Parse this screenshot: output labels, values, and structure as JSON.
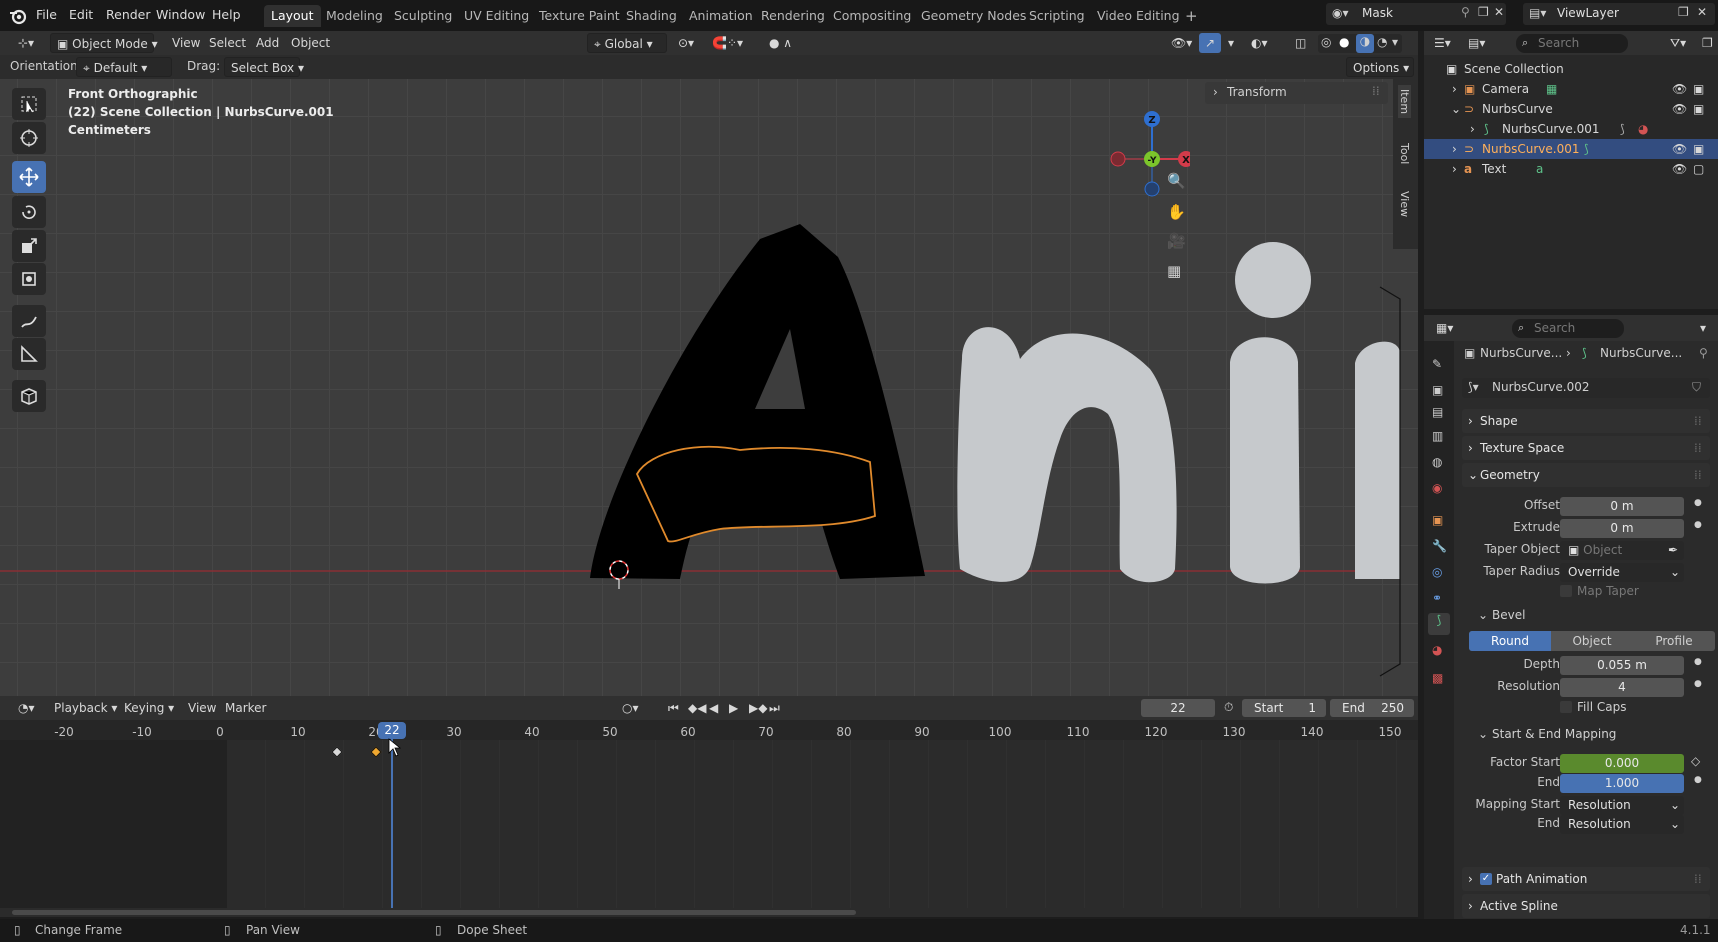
{
  "app": {
    "version": "4.1.1"
  },
  "menu": [
    "File",
    "Edit",
    "Render",
    "Window",
    "Help"
  ],
  "workspaces": [
    "Layout",
    "Modeling",
    "Sculpting",
    "UV Editing",
    "Texture Paint",
    "Shading",
    "Animation",
    "Rendering",
    "Compositing",
    "Geometry Nodes",
    "Scripting",
    "Video Editing"
  ],
  "scene_field": "Mask",
  "viewlayer_field": "ViewLayer",
  "viewport": {
    "mode": "Object Mode",
    "header_menus": [
      "View",
      "Select",
      "Add",
      "Object"
    ],
    "orientation_label": "Orientation:",
    "orientation": "Default",
    "drag_label": "Drag:",
    "drag": "Select Box",
    "transform_orientation": "Global",
    "options": "Options",
    "overlay_lines": [
      "Front Orthographic",
      "(22) Scene Collection | NurbsCurve.001",
      "Centimeters"
    ],
    "side_panel_title": "Transform",
    "side_tabs": [
      "Item",
      "Tool",
      "View"
    ],
    "axes": {
      "z": "Z",
      "y": "-Y",
      "x": "X"
    },
    "text_object": "Ani"
  },
  "outliner": {
    "search_placeholder": "Search",
    "rows": [
      {
        "label": "Scene Collection",
        "indent": 0
      },
      {
        "label": "Camera",
        "indent": 1
      },
      {
        "label": "NurbsCurve",
        "indent": 1
      },
      {
        "label": "NurbsCurve.001",
        "indent": 2
      },
      {
        "label": "NurbsCurve.001",
        "indent": 1,
        "selected": true
      },
      {
        "label": "Text",
        "indent": 1
      }
    ]
  },
  "properties": {
    "search_placeholder": "Search",
    "breadcrumb": [
      "NurbsCurve...",
      "NurbsCurve..."
    ],
    "datablock": "NurbsCurve.002",
    "sections": {
      "shape": "Shape",
      "texture_space": "Texture Space",
      "geometry": "Geometry",
      "bevel": "Bevel",
      "mapping": "Start & End Mapping",
      "path_animation": "Path Animation",
      "active_spline": "Active Spline"
    },
    "geometry": {
      "offset_label": "Offset",
      "offset": "0 m",
      "extrude_label": "Extrude",
      "extrude": "0 m",
      "taper_object_label": "Taper Object",
      "taper_object_placeholder": "Object",
      "taper_radius_label": "Taper Radius",
      "taper_radius": "Override",
      "map_taper": "Map Taper"
    },
    "bevel": {
      "modes": [
        "Round",
        "Object",
        "Profile"
      ],
      "active_mode": "Round",
      "depth_label": "Depth",
      "depth": "0.055 m",
      "resolution_label": "Resolution",
      "resolution": "4",
      "fill_caps": "Fill Caps"
    },
    "mapping": {
      "factor_start_label": "Factor Start",
      "factor_start": "0.000",
      "end_label": "End",
      "factor_end": "1.000",
      "mapping_start_label": "Mapping Start",
      "mapping_start": "Resolution",
      "mapping_end_label": "End",
      "mapping_end": "Resolution"
    }
  },
  "timeline": {
    "menus": [
      "Playback",
      "Keying",
      "View",
      "Marker"
    ],
    "current_frame": "22",
    "start_label": "Start",
    "start": "1",
    "end_label": "End",
    "end": "250",
    "ticks": [
      "-20",
      "-10",
      "0",
      "10",
      "20",
      "30",
      "40",
      "50",
      "60",
      "70",
      "80",
      "90",
      "100",
      "110",
      "120",
      "130",
      "140",
      "150"
    ],
    "keyframes": [
      15,
      20
    ]
  },
  "status": {
    "left": "Change Frame",
    "middle": "Pan View",
    "right": "Dope Sheet"
  },
  "colors": {
    "accent": "#4772b3",
    "selected_outline": "#e08a2c",
    "factor_green": "#5a8a2d",
    "playhead": "#4772b3"
  }
}
